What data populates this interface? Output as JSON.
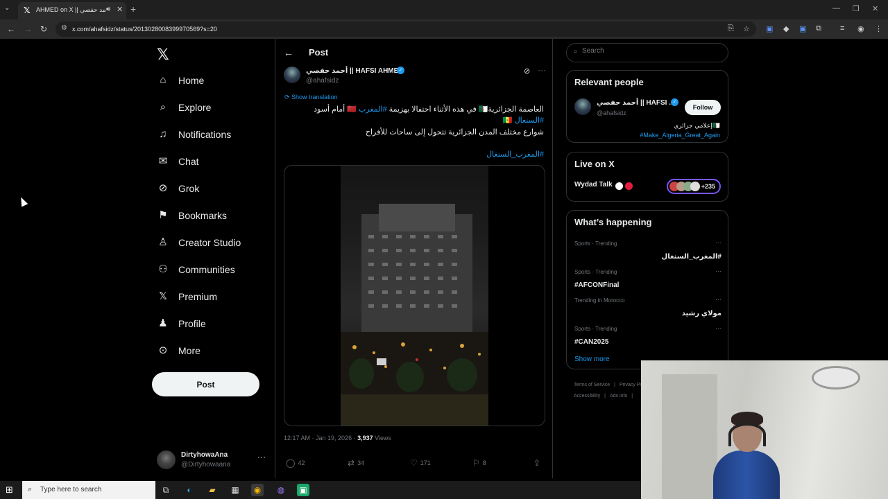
{
  "browser": {
    "tab_title": "AHMED on X || أحمد حفصي",
    "url": "x.com/ahafsidz/status/2013028008399970569?s=20"
  },
  "sidebar": {
    "items": [
      {
        "label": "Home",
        "icon": "home-icon"
      },
      {
        "label": "Explore",
        "icon": "search-icon"
      },
      {
        "label": "Notifications",
        "icon": "bell-icon"
      },
      {
        "label": "Chat",
        "icon": "mail-icon"
      },
      {
        "label": "Grok",
        "icon": "grok-icon"
      },
      {
        "label": "Bookmarks",
        "icon": "bookmark-icon"
      },
      {
        "label": "Creator Studio",
        "icon": "creator-studio-icon"
      },
      {
        "label": "Communities",
        "icon": "communities-icon"
      },
      {
        "label": "Premium",
        "icon": "x-logo-icon"
      },
      {
        "label": "Profile",
        "icon": "person-icon"
      },
      {
        "label": "More",
        "icon": "more-circle-icon"
      }
    ],
    "post_label": "Post",
    "account": {
      "name": "DirtyhowaAna",
      "handle": "@Dirtyhowaana"
    }
  },
  "post": {
    "header": "Post",
    "author_name": "أحمد حفصي || HAFSI AHMED",
    "author_handle": "@ahafsidz",
    "show_translation": "Show translation",
    "line1": "العاصمة الجزائرية🇩🇿 في هذه الأثناء احتفالا بهزيمة",
    "line1_link": "#المغرب",
    "line1_tail": "🇲🇦 أمام أسود",
    "line2_link": "#السنغال",
    "line2_tail": "🇸🇳",
    "line3": "شوارع مختلف المدن الجزائرية تتحول إلى ساحات  للأفراح",
    "hashtag": "#المغرب_السنغال",
    "time": "12:17 AM · Jan 19, 2026 · ",
    "views_count": "3,937",
    "views_label": " Views",
    "replies": "42",
    "reposts": "34",
    "likes": "171",
    "bookmarks": "8"
  },
  "right": {
    "search_placeholder": "Search",
    "relevant_title": "Relevant people",
    "rp_name": "أحمد حفصي || HAFSI ...",
    "rp_handle": "@ahafsidz",
    "follow": "Follow",
    "rp_bio": "🇩🇿إعلامي جزائري",
    "rp_link": "#Make_Algeria_Great_Again",
    "live_title": "Live on X",
    "live_host": "Wydad Talk",
    "live_count": "+235",
    "happening_title": "What’s happening",
    "trends": [
      {
        "context": "Sports · Trending",
        "title": "#المغرب_السنغال",
        "rtl": true
      },
      {
        "context": "Sports · Trending",
        "title": "#AFCONFinal",
        "rtl": false
      },
      {
        "context": "Trending in Morocco",
        "title": "مولاي رشيد",
        "rtl": true
      },
      {
        "context": "Sports · Trending",
        "title": "#CAN2025",
        "rtl": false
      }
    ],
    "show_more": "Show more",
    "footer": [
      "Terms of Service",
      "|",
      "Privacy Po",
      "Accessibility",
      "|",
      "Ads info",
      "|"
    ]
  },
  "taskbar": {
    "search_text": "Type here to search"
  },
  "colors": {
    "accent": "#1d9bf0",
    "background": "#000000",
    "border": "#2f3336",
    "muted": "#71767b"
  }
}
